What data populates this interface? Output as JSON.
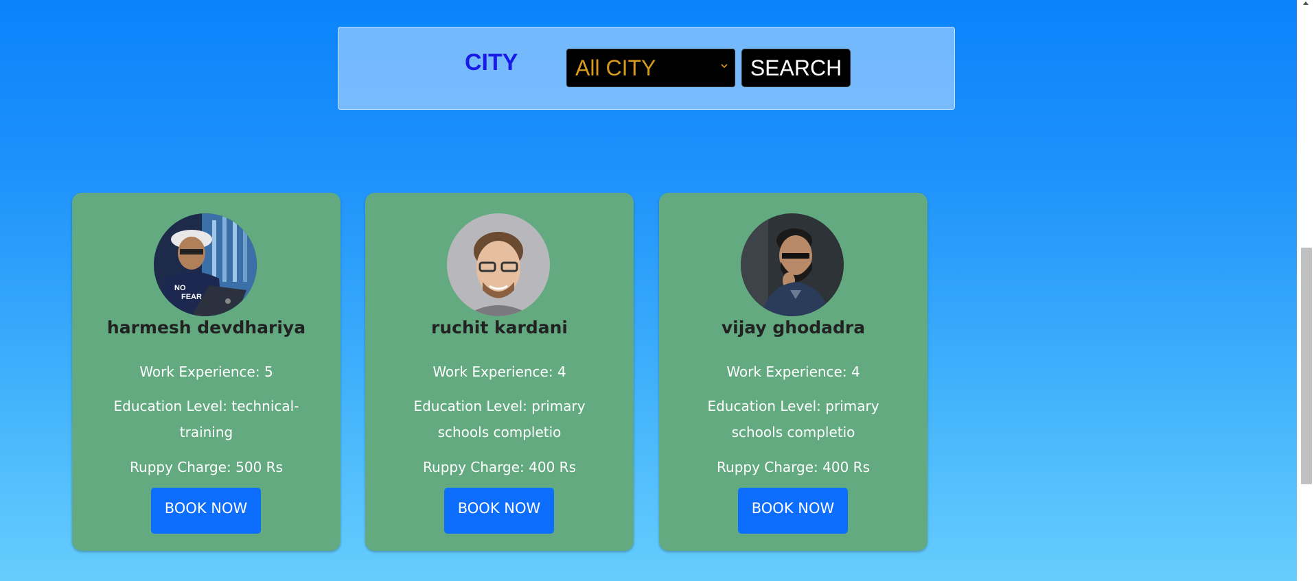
{
  "filter": {
    "city_label": "CITY",
    "select_value": "All CITY",
    "search_label": "SEARCH"
  },
  "cards": [
    {
      "name": "harmesh devdhariya",
      "work_experience": "Work Experience: 5",
      "education": "Education Level: technical-training",
      "charge": "Ruppy Charge: 500 Rs",
      "book_label": "BOOK NOW"
    },
    {
      "name": "ruchit kardani",
      "work_experience": "Work Experience: 4",
      "education": "Education Level: primary schools completio",
      "charge": "Ruppy Charge: 400 Rs",
      "book_label": "BOOK NOW"
    },
    {
      "name": "vijay ghodadra",
      "work_experience": "Work Experience: 4",
      "education": "Education Level: primary schools completio",
      "charge": "Ruppy Charge: 400 Rs",
      "book_label": "BOOK NOW"
    }
  ],
  "colors": {
    "card_background": "#63aa80",
    "book_button": "#0d6efd",
    "city_label": "#1a1ae8",
    "select_text": "#d99a1b"
  }
}
